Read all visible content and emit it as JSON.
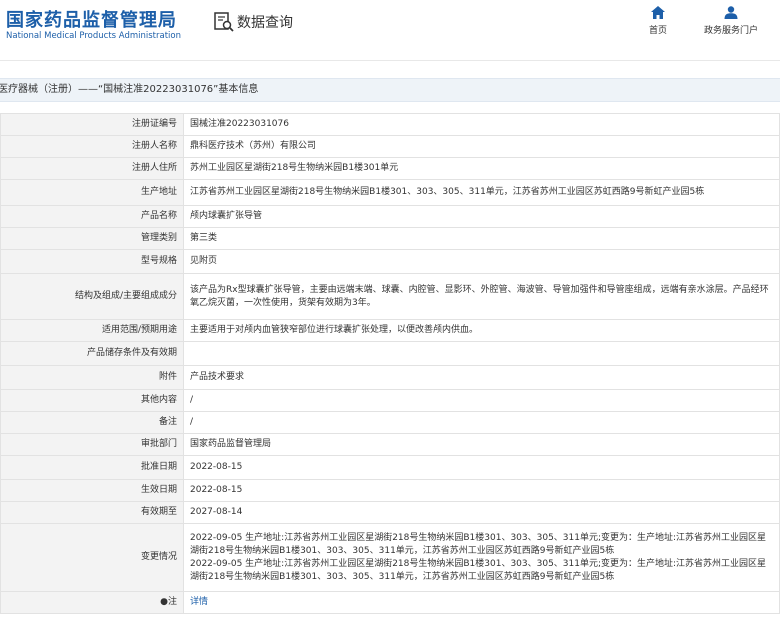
{
  "header": {
    "logo_cn": "国家药品监督管理局",
    "logo_en": "National Medical Products Administration",
    "query_icon": "search-document-icon",
    "query_label": "数据查询",
    "nav": [
      {
        "label": "首页",
        "icon": "home-icon"
      },
      {
        "label": "政务服务门户",
        "icon": "user-icon"
      }
    ]
  },
  "title": "医疗器械（注册）——“国械注准20223031076”基本信息",
  "rows": [
    {
      "label": "注册证编号",
      "value": "国械注准20223031076"
    },
    {
      "label": "注册人名称",
      "value": "鼎科医疗技术（苏州）有限公司"
    },
    {
      "label": "注册人住所",
      "value": "苏州工业园区星湖街218号生物纳米园B1楼301单元"
    },
    {
      "label": "生产地址",
      "value": "江苏省苏州工业园区星湖街218号生物纳米园B1楼301、303、305、311单元，江苏省苏州工业园区苏虹西路9号新虹产业园5栋"
    },
    {
      "label": "产品名称",
      "value": "颅内球囊扩张导管"
    },
    {
      "label": "管理类别",
      "value": "第三类"
    },
    {
      "label": "型号规格",
      "value": "见附页"
    },
    {
      "label": "结构及组成/主要组成成分",
      "value": "该产品为Rx型球囊扩张导管，主要由远端末端、球囊、内腔管、显影环、外腔管、海波管、导管加强件和导管座组成，远端有亲水涂层。产品经环氧乙烷灭菌，一次性使用，货架有效期为3年。"
    },
    {
      "label": "适用范围/预期用途",
      "value": "主要适用于对颅内血管狭窄部位进行球囊扩张处理，以便改善颅内供血。"
    },
    {
      "label": "产品储存条件及有效期",
      "value": ""
    },
    {
      "label": "附件",
      "value": "产品技术要求"
    },
    {
      "label": "其他内容",
      "value": "/"
    },
    {
      "label": "备注",
      "value": "/"
    },
    {
      "label": "审批部门",
      "value": "国家药品监督管理局"
    },
    {
      "label": "批准日期",
      "value": "2022-08-15"
    },
    {
      "label": "生效日期",
      "value": "2022-08-15"
    },
    {
      "label": "有效期至",
      "value": "2027-08-14"
    },
    {
      "label": "变更情况",
      "value": "2022-09-05 生产地址:江苏省苏州工业园区星湖街218号生物纳米园B1楼301、303、305、311单元;变更为：生产地址:江苏省苏州工业园区星湖街218号生物纳米园B1楼301、303、305、311单元，江苏省苏州工业园区苏虹西路9号新虹产业园5栋\n2022-09-05 生产地址:江苏省苏州工业园区星湖街218号生物纳米园B1楼301、303、305、311单元;变更为：生产地址:江苏省苏州工业园区星湖街218号生物纳米园B1楼301、303、305、311单元，江苏省苏州工业园区苏虹西路9号新虹产业园5栋"
    },
    {
      "label": "●注",
      "value": "详情",
      "link": true
    }
  ]
}
